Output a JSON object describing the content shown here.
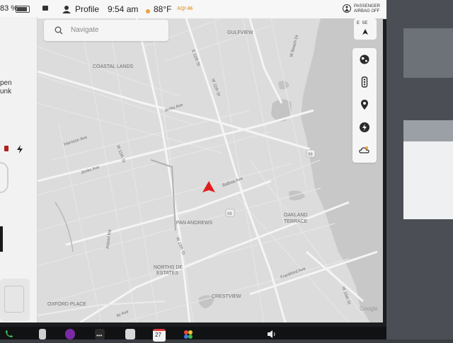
{
  "status": {
    "battery": "83 %",
    "profile": "Profile",
    "time": "9:54 am",
    "temperature": "88°F",
    "aqi": "AQI 46",
    "airbag_line1": "PASSENGER",
    "airbag_line2": "AIRBAG OFF"
  },
  "left_panel": {
    "text_line1": "pen",
    "text_line2": "unk"
  },
  "navigate": {
    "placeholder": "Navigate"
  },
  "compass": {
    "heading": "E  SE"
  },
  "map": {
    "labels": {
      "gulfview": "GULFVIEW",
      "w_beach_dr": "W Beach Dr",
      "coastal_lands": "COASTAL LANDS",
      "e_11th_st": "E 11th St",
      "w_11th_st_top": "W 11th St",
      "jenks_ave_top": "Jenks Ave",
      "harrison_ave": "Harrison Ave",
      "w_11th_st_mid": "W 11th St",
      "jenks_ave_left": "Jenks Ave",
      "balboa_ave": "Balboa Ave",
      "route_98_a": "98",
      "route_98_b": "98",
      "pan_andrews": "PAN ANDREWS",
      "oakland_terrace_1": "OAKLAND",
      "oakland_terrace_2": "TERRACE",
      "airport_rd": "Airport Rd",
      "w_19th_st": "W 19th St",
      "northside_1": "NORTHS DE",
      "northside_2": "ESTATES",
      "frankford_ave": "Frankford Ave",
      "crestview": "CRESTVIEW",
      "oxford_place": "OXFORD PLACE",
      "w_15th_st": "W 15th St",
      "bay_ave": "ay Ave",
      "google": "Google"
    }
  },
  "taskbar": {
    "calendar_day": "27"
  },
  "colors": {
    "vehicle_arrow": "#e01e1e",
    "map_bg": "#dcdcdc",
    "road": "#f4f4f4"
  }
}
